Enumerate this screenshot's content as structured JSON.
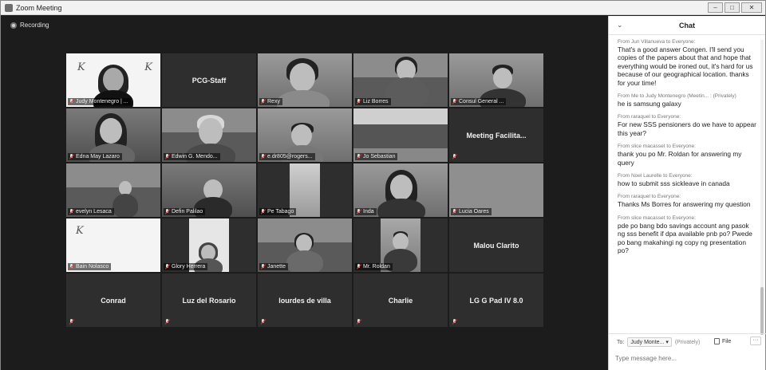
{
  "window": {
    "title": "Zoom Meeting",
    "controls": [
      "–",
      "□",
      "✕"
    ]
  },
  "recording": {
    "label": "Recording"
  },
  "tiles": [
    {
      "name": "Judy Montenegro | ...",
      "video": true,
      "active": true
    },
    {
      "name": "PCG-Staff",
      "video": false
    },
    {
      "name": "Rexy",
      "video": true
    },
    {
      "name": "Liz Borres",
      "video": true
    },
    {
      "name": "Consul General ...",
      "video": true
    },
    {
      "name": "Edna May Lazaro",
      "video": true
    },
    {
      "name": "Edwin G. Mendo...",
      "video": true
    },
    {
      "name": "e.dr805@rogers...",
      "video": true
    },
    {
      "name": "Jo Sebastian",
      "video": true
    },
    {
      "name": "Meeting Facilita...",
      "video": false
    },
    {
      "name": "evelyn Lesaca",
      "video": true
    },
    {
      "name": "Defin Palilao",
      "video": true
    },
    {
      "name": "Pe Tabago",
      "video": true
    },
    {
      "name": "Inda",
      "video": true
    },
    {
      "name": "Lucia Oares",
      "video": true
    },
    {
      "name": "Bain Nolasco",
      "video": true
    },
    {
      "name": "Glory Herrera",
      "video": true
    },
    {
      "name": "Janette",
      "video": true
    },
    {
      "name": "Mr. Roldan",
      "video": true
    },
    {
      "name": "Malou Clarito",
      "video": false
    },
    {
      "name": "Conrad",
      "video": false
    },
    {
      "name": "Luz del Rosario",
      "video": false
    },
    {
      "name": "lourdes de villa",
      "video": false
    },
    {
      "name": "Charlie",
      "video": false
    },
    {
      "name": "LG G Pad IV 8.0",
      "video": false
    }
  ],
  "chat": {
    "title": "Chat",
    "messages": [
      {
        "from": "From Jun Villanueva to Everyone:",
        "text": "That's a good answer Congen. I'll send you copies of the papers about that and hope that everything would be ironed out, it's hard for us because of our geographical location. thanks for your time!"
      },
      {
        "from": "From Me to Judy Montenegro (Meetin... : (Privately)",
        "text": "he is samsung galaxy"
      },
      {
        "from": "From raraquel to Everyone:",
        "text": "For new SSS pensioners do we have to appear this year?"
      },
      {
        "from": "From slice macasset to Everyone:",
        "text": "thank you po Mr. Roldan for answering my query"
      },
      {
        "from": "From Noel Laurelle to Everyone:",
        "text": "how to submit sss sickleave in canada"
      },
      {
        "from": "From raraquel to Everyone:",
        "text": "Thanks Ms Borres for answering my question"
      },
      {
        "from": "From slice macasset to Everyone:",
        "text": "pde po bang bdo savings account ang pasok ng sss benefit if dpa available pnb po? Pwede po bang makahingi ng copy ng presentation po?"
      }
    ],
    "to_label": "To:",
    "to_value": "Judy Monte...",
    "privately": "(Privately)",
    "file_label": "File",
    "more_label": "···",
    "input_placeholder": "Type message here..."
  }
}
